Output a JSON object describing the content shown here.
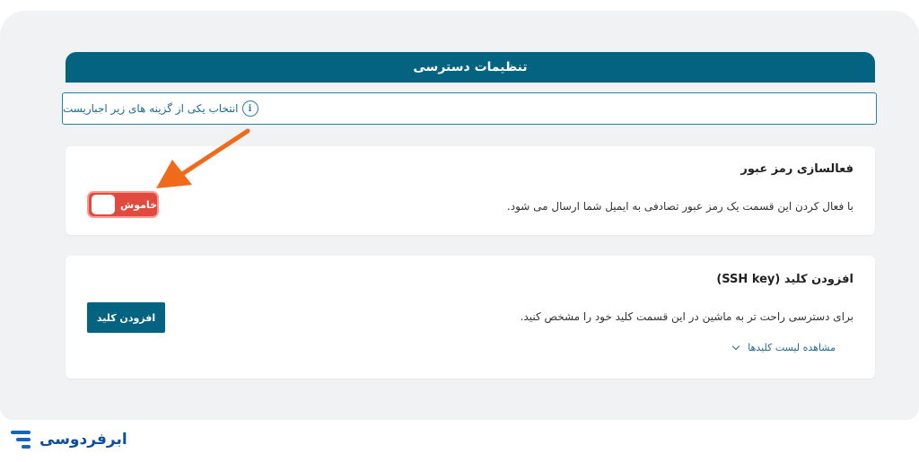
{
  "header": {
    "title": "تنظیمات دسترسی"
  },
  "notice": {
    "icon": "info-icon",
    "text": "انتخاب یکی از گزینه های زیر اجباریست"
  },
  "password_card": {
    "title": "فعالسازی رمز عبور",
    "description": "با فعال کردن این قسمت یک رمز عبور تصادفی به ایمیل شما ارسال می شود.",
    "toggle_label": "خاموش",
    "toggle_state": "off"
  },
  "ssh_card": {
    "title": "افزودن کلید (SSH key)",
    "description": "برای دسترسی راحت تر به ماشین در این قسمت کلید خود را مشخص کنید.",
    "button_label": "افزودن کلید",
    "keys_link": "مشاهده لیست کلیدها"
  },
  "brand": {
    "name": "ابرفردوسی"
  },
  "colors": {
    "primary": "#046380",
    "toggle_off": "#e04a3f",
    "arrow": "#f06a1c",
    "brand": "#0d4f9e"
  }
}
